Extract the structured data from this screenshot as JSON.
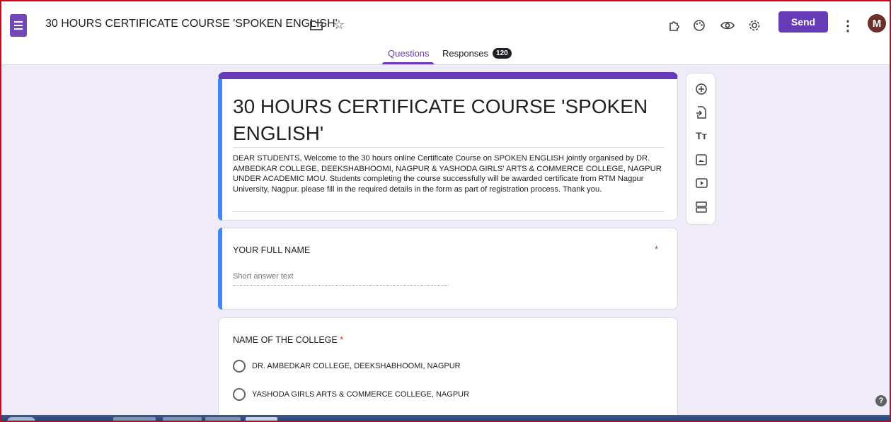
{
  "header": {
    "doc_title": "30 HOURS CERTIFICATE COURSE 'SPOKEN ENGLISH'",
    "send_label": "Send",
    "avatar_letter": "M"
  },
  "tabs": {
    "questions_label": "Questions",
    "responses_label": "Responses",
    "responses_count": "120"
  },
  "form": {
    "title": "30 HOURS CERTIFICATE COURSE 'SPOKEN ENGLISH'",
    "description": "DEAR STUDENTS, Welcome to the 30 hours online Certificate Course on SPOKEN ENGLISH jointly organised by DR. AMBEDKAR COLLEGE, DEEKSHABHOOMI, NAGPUR & YASHODA GIRLS' ARTS & COMMERCE COLLEGE, NAGPUR UNDER ACADEMIC MOU. Students completing the course successfully will be awarded certificate from RTM Nagpur University, Nagpur. please fill in the required details in the form as part of registration process. Thank you."
  },
  "questions": [
    {
      "title": "YOUR FULL NAME",
      "required_mark": "*",
      "placeholder": "Short answer text"
    },
    {
      "title": "NAME OF THE COLLEGE",
      "required_mark": "*",
      "options": [
        "DR. AMBEDKAR COLLEGE, DEEKSHABHOOMI, NAGPUR",
        "YASHODA GIRLS ARTS & COMMERCE COLLEGE, NAGPUR"
      ]
    }
  ],
  "toolbar_icons": [
    "add-question-icon",
    "import-questions-icon",
    "add-title-icon",
    "add-image-icon",
    "add-video-icon",
    "add-section-icon"
  ],
  "colors": {
    "accent": "#673ab7",
    "background": "#f0ebf8",
    "active_border": "#4285f4",
    "required": "#d93025"
  }
}
